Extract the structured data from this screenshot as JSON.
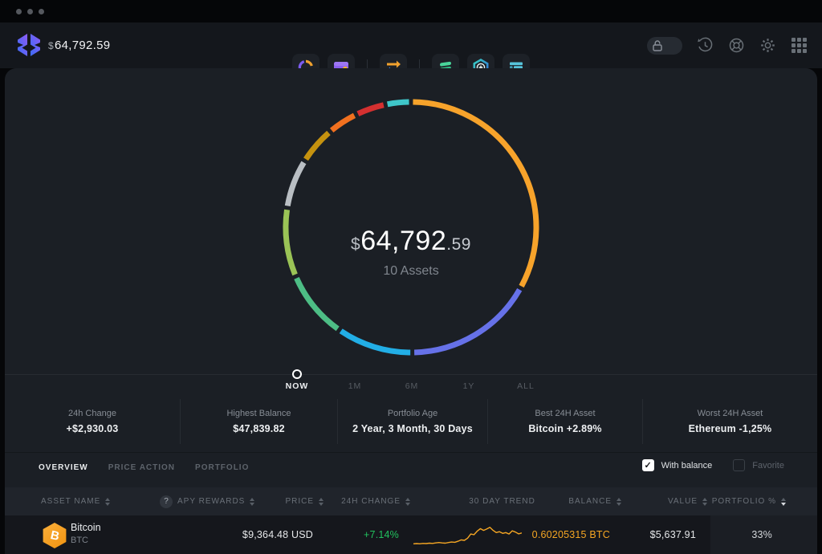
{
  "header": {
    "balance_currency": "$",
    "balance": "64,792.59",
    "nav": [
      {
        "name": "portfolio",
        "icon": "donut-chart-icon",
        "active": true
      },
      {
        "name": "wallet",
        "icon": "wallet-icon",
        "active": false
      },
      {
        "name": "exchange",
        "icon": "swap-arrows-icon",
        "active": false
      },
      {
        "name": "app-compound",
        "icon": "compound-app-icon",
        "active": false
      },
      {
        "name": "app-rewards",
        "icon": "hexagon-plus-app-icon",
        "active": false
      },
      {
        "name": "app-markets",
        "icon": "bars-app-icon",
        "active": false
      }
    ],
    "right_controls": [
      "lock-toggle",
      "history",
      "support",
      "settings",
      "apps-grid"
    ]
  },
  "chart_data": {
    "type": "pie",
    "title": "Portfolio allocation donut",
    "center_value_currency": "$",
    "center_value_main": "64,792",
    "center_value_cents": ".59",
    "center_sub": "10 Assets",
    "segments": [
      {
        "name": "bitcoin",
        "color": "#f7a32b",
        "percent": 33.0
      },
      {
        "name": "asset-2",
        "color": "#6671e8",
        "percent": 16.5
      },
      {
        "name": "asset-3",
        "color": "#22aee6",
        "percent": 9.5
      },
      {
        "name": "asset-4",
        "color": "#4dbd85",
        "percent": 8.5
      },
      {
        "name": "asset-5",
        "color": "#9ac356",
        "percent": 8.5
      },
      {
        "name": "asset-6",
        "color": "#b9bec3",
        "percent": 6.0
      },
      {
        "name": "asset-7",
        "color": "#c5920f",
        "percent": 4.5
      },
      {
        "name": "asset-8",
        "color": "#f1701f",
        "percent": 3.5
      },
      {
        "name": "asset-9",
        "color": "#d43030",
        "percent": 3.5
      },
      {
        "name": "asset-10",
        "color": "#3fc6c9",
        "percent": 2.8
      }
    ]
  },
  "timeline": {
    "markers": [
      {
        "label": "NOW",
        "active": true
      },
      {
        "label": "1M",
        "active": false
      },
      {
        "label": "6M",
        "active": false
      },
      {
        "label": "1Y",
        "active": false
      },
      {
        "label": "ALL",
        "active": false
      }
    ]
  },
  "stats": [
    {
      "label": "24h Change",
      "value": "+$2,930.03"
    },
    {
      "label": "Highest Balance",
      "value": "$47,839.82"
    },
    {
      "label": "Portfolio Age",
      "value": "2 Year, 3 Month, 30 Days"
    },
    {
      "label": "Best 24H Asset",
      "value": "Bitcoin +2.89%"
    },
    {
      "label": "Worst 24H Asset",
      "value": "Ethereum -1,25%"
    }
  ],
  "table": {
    "tabs": [
      {
        "label": "OVERVIEW",
        "active": true
      },
      {
        "label": "PRICE ACTION",
        "active": false
      },
      {
        "label": "PORTFOLIO",
        "active": false
      }
    ],
    "filters": [
      {
        "label": "With balance",
        "checked": true
      },
      {
        "label": "Favorite",
        "checked": false
      }
    ],
    "check_glyph": "✓",
    "help_glyph": "?",
    "columns": [
      {
        "label": "ASSET NAME",
        "sort": true,
        "help": false,
        "active_sort": null
      },
      {
        "label": "APY REWARDS",
        "sort": true,
        "help": true,
        "active_sort": null
      },
      {
        "label": "PRICE",
        "sort": true,
        "help": false,
        "active_sort": null
      },
      {
        "label": "24H CHANGE",
        "sort": true,
        "help": false,
        "active_sort": null
      },
      {
        "label": "30 DAY TREND",
        "sort": false,
        "help": false,
        "active_sort": null
      },
      {
        "label": "BALANCE",
        "sort": true,
        "help": false,
        "active_sort": null
      },
      {
        "label": "VALUE",
        "sort": true,
        "help": false,
        "active_sort": null
      },
      {
        "label": "PORTFOLIO %",
        "sort": true,
        "help": false,
        "active_sort": "desc"
      }
    ],
    "rows": [
      {
        "name": "Bitcoin",
        "symbol": "BTC",
        "badge_glyph": "B",
        "price": "$9,364.48 USD",
        "change": "+7.14%",
        "balance": "0.60205315 BTC",
        "value": "$5,637.91",
        "portfolio_pct": "33%",
        "trend_color": "#f5a623",
        "trend": [
          0.1,
          0.11,
          0.1,
          0.12,
          0.11,
          0.13,
          0.12,
          0.14,
          0.16,
          0.14,
          0.13,
          0.16,
          0.18,
          0.17,
          0.22,
          0.28,
          0.26,
          0.36,
          0.55,
          0.52,
          0.68,
          0.8,
          0.72,
          0.78,
          0.86,
          0.72,
          0.62,
          0.66,
          0.58,
          0.62,
          0.55,
          0.7,
          0.64,
          0.56,
          0.6
        ]
      }
    ]
  }
}
